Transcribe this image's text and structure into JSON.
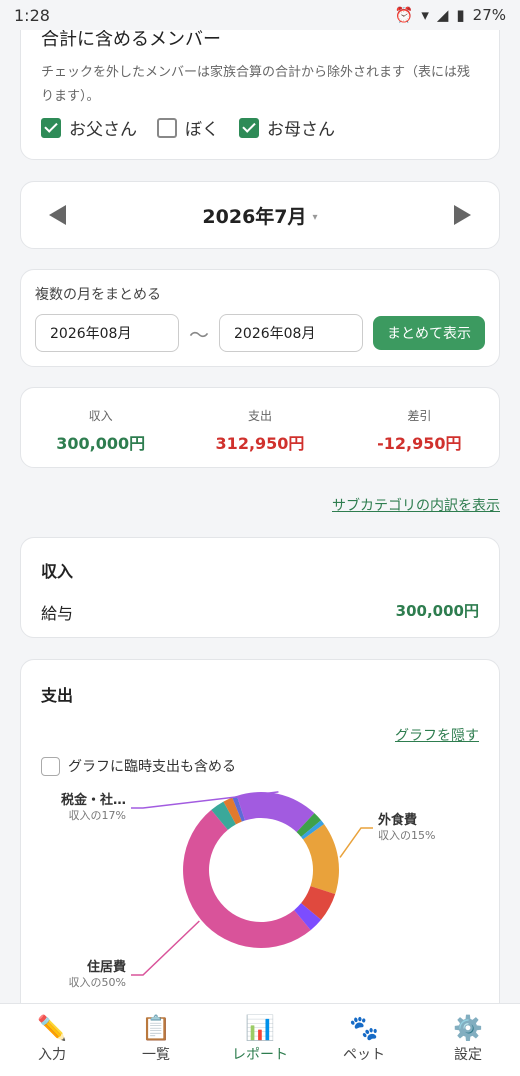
{
  "status": {
    "time": "1:28",
    "battery": "27%"
  },
  "members": {
    "title": "合計に含めるメンバー",
    "description": "チェックを外したメンバーは家族合算の合計から除外されます（表には残ります）。",
    "list": [
      {
        "name": "お父さん",
        "checked": true
      },
      {
        "name": "ぼく",
        "checked": false
      },
      {
        "name": "お母さん",
        "checked": true
      }
    ]
  },
  "month_nav": {
    "current": "2026年7月",
    "dropdown_glyph": "▾"
  },
  "range": {
    "label": "複数の月をまとめる",
    "from": "2026年08月",
    "separator": "〜",
    "to": "2026年08月",
    "button": "まとめて表示"
  },
  "summary": {
    "income_label": "収入",
    "income_value": "300,000円",
    "expense_label": "支出",
    "expense_value": "312,950円",
    "diff_label": "差引",
    "diff_value": "-12,950円"
  },
  "subcategory_link": "サブカテゴリの内訳を表示",
  "income": {
    "title": "収入",
    "rows": [
      {
        "label": "給与",
        "amount": "300,000円"
      }
    ]
  },
  "expense": {
    "title": "支出",
    "hide_graph": "グラフを隠す",
    "include_temp": "グラフに臨時支出も含める"
  },
  "chart_data": {
    "type": "pie",
    "donut": true,
    "slices": [
      {
        "label": "住居費",
        "note": "収入の50%",
        "value": 50,
        "color": "#d9539a"
      },
      {
        "label": "税金・社…",
        "note": "収入の17%",
        "value": 17,
        "color": "#a25be0"
      },
      {
        "label": "外食費",
        "note": "収入の15%",
        "value": 15,
        "color": "#e9a23b"
      },
      {
        "value": 6,
        "color": "#e0493e"
      },
      {
        "value": 3,
        "color": "#7c4dff"
      },
      {
        "value": 3,
        "color": "#3aa89a"
      },
      {
        "value": 2,
        "color": "#e07a2e"
      },
      {
        "value": 2,
        "color": "#3fa14a"
      },
      {
        "value": 1,
        "color": "#3aa1e0"
      },
      {
        "value": 1,
        "color": "#5e6bd6"
      }
    ]
  },
  "nav": [
    {
      "label": "入力",
      "icon": "pencil-icon",
      "glyph": "✏️",
      "active": false
    },
    {
      "label": "一覧",
      "icon": "clipboard-icon",
      "glyph": "📋",
      "active": false
    },
    {
      "label": "レポート",
      "icon": "chart-icon",
      "glyph": "📊",
      "active": true
    },
    {
      "label": "ペット",
      "icon": "paw-icon",
      "glyph": "🐾",
      "active": false
    },
    {
      "label": "設定",
      "icon": "gear-icon",
      "glyph": "⚙️",
      "active": false
    }
  ]
}
